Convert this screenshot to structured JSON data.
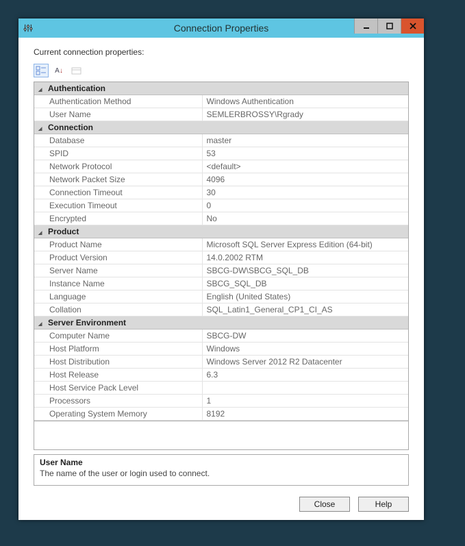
{
  "window": {
    "title": "Connection Properties",
    "icon": "sliders-icon"
  },
  "label": "Current connection properties:",
  "toolbar": {
    "categorized": "categorized-icon",
    "alphabetical": "alphabetical-icon",
    "pages": "property-pages-icon"
  },
  "categories": [
    {
      "name": "Authentication",
      "rows": [
        {
          "k": "Authentication Method",
          "v": "Windows Authentication"
        },
        {
          "k": "User Name",
          "v": "SEMLERBROSSY\\Rgrady"
        }
      ]
    },
    {
      "name": "Connection",
      "rows": [
        {
          "k": "Database",
          "v": "master"
        },
        {
          "k": "SPID",
          "v": "53"
        },
        {
          "k": "Network Protocol",
          "v": "<default>"
        },
        {
          "k": "Network Packet Size",
          "v": "4096"
        },
        {
          "k": "Connection Timeout",
          "v": "30"
        },
        {
          "k": "Execution Timeout",
          "v": "0"
        },
        {
          "k": "Encrypted",
          "v": "No"
        }
      ]
    },
    {
      "name": "Product",
      "rows": [
        {
          "k": "Product Name",
          "v": "Microsoft SQL Server Express Edition (64-bit)"
        },
        {
          "k": "Product Version",
          "v": "14.0.2002 RTM"
        },
        {
          "k": "Server Name",
          "v": "SBCG-DW\\SBCG_SQL_DB"
        },
        {
          "k": "Instance Name",
          "v": "SBCG_SQL_DB"
        },
        {
          "k": "Language",
          "v": "English (United States)"
        },
        {
          "k": "Collation",
          "v": "SQL_Latin1_General_CP1_CI_AS"
        }
      ]
    },
    {
      "name": "Server Environment",
      "rows": [
        {
          "k": "Computer Name",
          "v": "SBCG-DW"
        },
        {
          "k": "Host Platform",
          "v": "Windows"
        },
        {
          "k": "Host Distribution",
          "v": "Windows Server 2012 R2 Datacenter"
        },
        {
          "k": "Host Release",
          "v": "6.3"
        },
        {
          "k": "Host Service Pack Level",
          "v": ""
        },
        {
          "k": "Processors",
          "v": "1"
        },
        {
          "k": "Operating System Memory",
          "v": "8192"
        }
      ]
    }
  ],
  "help": {
    "title": "User Name",
    "desc": "The name of the user or login used to connect."
  },
  "buttons": {
    "close": "Close",
    "help": "Help"
  }
}
